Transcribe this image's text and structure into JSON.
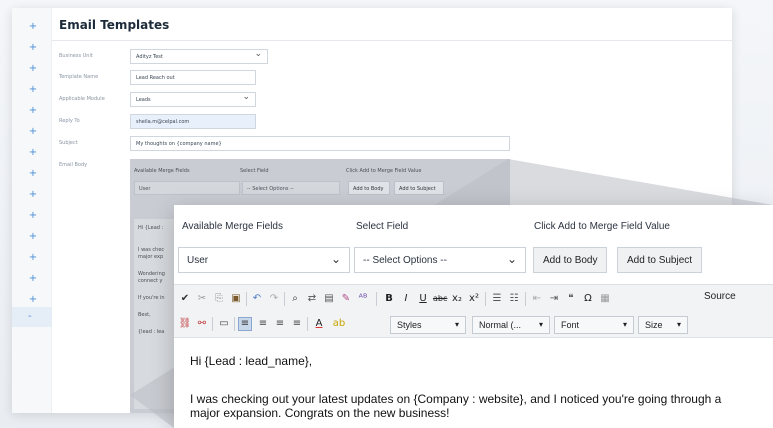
{
  "page": {
    "title": "Email Templates"
  },
  "form": {
    "business_unit": {
      "label": "Business Unit",
      "value": "Adityz Test"
    },
    "template_name": {
      "label": "Template Name",
      "value": "Lead Reach out"
    },
    "applicable_module": {
      "label": "Applicable Module",
      "value": "Leads"
    },
    "reply_to": {
      "label": "Reply To",
      "value": "sheila.m@celpal.com"
    },
    "subject": {
      "label": "Subject",
      "value": "My thoughts on {company name}"
    },
    "email_body": {
      "label": "Email Body"
    }
  },
  "merge": {
    "available_label": "Available Merge Fields",
    "select_field_label": "Select Field",
    "click_add_label": "Click Add to Merge Field Value",
    "available_value": "User",
    "select_value": "-- Select Options --",
    "add_to_body": "Add to Body",
    "add_to_subject": "Add to Subject"
  },
  "mini_preview": {
    "greeting": "Hi {Lead :",
    "line1a": "I was chec",
    "line1b": "major exp",
    "line2a": "Wondering",
    "line2b": "connect y",
    "line3": "If you're in",
    "line4": "Best,",
    "line5": "{lead : lea"
  },
  "toolbar": {
    "styles": "Styles",
    "format": "Normal (...",
    "font": "Font",
    "size": "Size",
    "source": "Source"
  },
  "editor": {
    "greeting": "Hi {Lead : lead_name},",
    "para1_line1": "I was checking out your latest updates on {Company : website}, and I noticed you're going through a",
    "para1_line2": "major expansion. Congrats on the new business!"
  },
  "colors": {
    "accent": "#4a8ed6",
    "title": "#1c2b3a"
  }
}
